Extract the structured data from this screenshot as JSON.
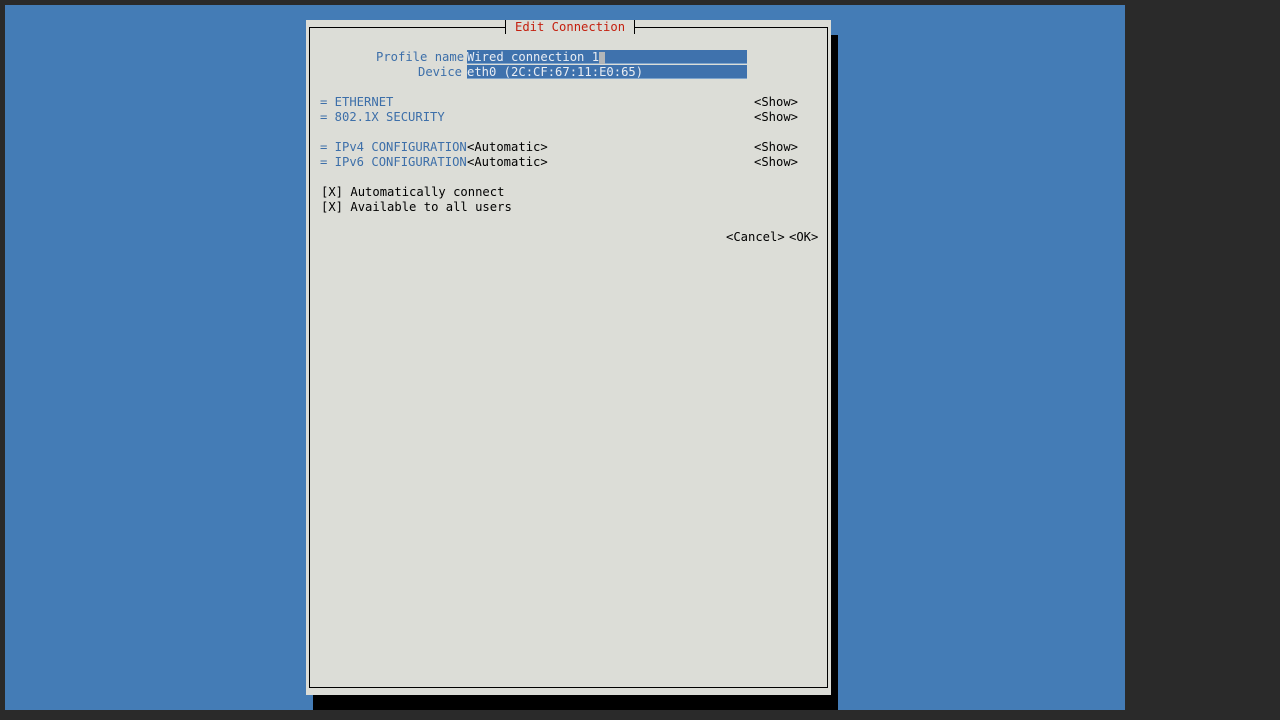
{
  "dialog": {
    "title": "Edit Connection",
    "profile_name_label": "Profile name",
    "profile_name_value": "Wired connection 1",
    "device_label": "Device",
    "device_value": "eth0 (2C:CF:67:11:E0:65)"
  },
  "sections": [
    {
      "label": "= ETHERNET",
      "value": "",
      "show": "<Show>"
    },
    {
      "label": "= 802.1X SECURITY",
      "value": "",
      "show": "<Show>"
    },
    {
      "label": "= IPv4 CONFIGURATION",
      "value": "<Automatic>",
      "show": "<Show>"
    },
    {
      "label": "= IPv6 CONFIGURATION",
      "value": "<Automatic>",
      "show": "<Show>"
    }
  ],
  "options": [
    {
      "check": "[X]",
      "label": "Automatically connect"
    },
    {
      "check": "[X]",
      "label": "Available to all users"
    }
  ],
  "buttons": {
    "cancel": "<Cancel>",
    "ok": "<OK>"
  }
}
